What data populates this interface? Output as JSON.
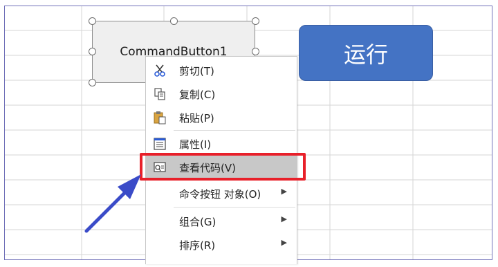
{
  "command_button": {
    "label": "CommandButton1"
  },
  "run_button": {
    "label": "运行"
  },
  "menu": {
    "items": [
      {
        "label": "剪切(T)",
        "icon": "scissors-icon"
      },
      {
        "label": "复制(C)",
        "icon": "copy-icon"
      },
      {
        "label": "粘贴(P)",
        "icon": "paste-icon"
      },
      {
        "label": "属性(I)",
        "icon": "properties-icon"
      },
      {
        "label": "查看代码(V)",
        "icon": "view-code-icon",
        "highlighted": true
      },
      {
        "label": "命令按钮 对象(O)",
        "submenu": true
      },
      {
        "label": "组合(G)",
        "submenu": true
      },
      {
        "label": "排序(R)",
        "submenu": true
      }
    ]
  },
  "annotation": {
    "highlight_color": "#e8202a",
    "arrow_color": "#3a4bc8"
  }
}
